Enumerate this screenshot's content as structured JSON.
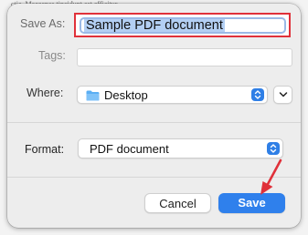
{
  "background": {
    "text_fragment": "ctie. Maecenas tincidunt est efficitur"
  },
  "dialog": {
    "save_as": {
      "label": "Save As:",
      "value": "Sample PDF document"
    },
    "tags": {
      "label": "Tags:",
      "value": ""
    },
    "where": {
      "label": "Where:",
      "value": "Desktop",
      "icon": "folder-icon"
    },
    "format": {
      "label": "Format:",
      "value": "PDF document"
    },
    "buttons": {
      "cancel": "Cancel",
      "save": "Save"
    }
  },
  "colors": {
    "accent": "#2f80ec",
    "highlight_border": "#e0313a",
    "annotation_arrow": "#e0313a"
  }
}
